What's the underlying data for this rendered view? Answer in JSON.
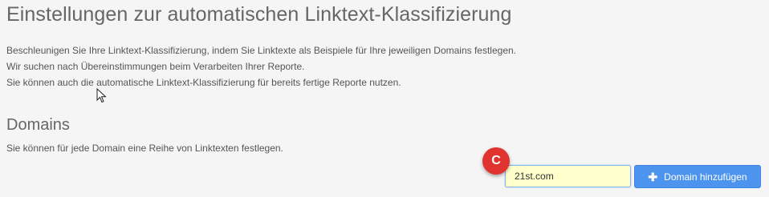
{
  "header": {
    "title": "Einstellungen zur automatischen Linktext-Klassifizierung"
  },
  "intro": {
    "line1": "Beschleunigen Sie Ihre Linktext-Klassifizierung, indem Sie Linktexte als Beispiele für Ihre jeweiligen Domains festlegen.",
    "line2": "Wir suchen nach Übereinstimmungen beim Verarbeiten Ihrer Reporte.",
    "line3": "Sie können auch die automatische Linktext-Klassifizierung für bereits fertige Reporte nutzen."
  },
  "domains": {
    "title": "Domains",
    "description": "Sie können für jede Domain eine Reihe von Linktexten festlegen.",
    "input_value": "21st.com",
    "add_button_label": "Domain hinzufügen",
    "add_button_icon": "plus-icon"
  },
  "annotation": {
    "marker_label": "C"
  },
  "colors": {
    "accent": "#4d94ee",
    "input_highlight": "#ffffcc",
    "marker": "#e0332f"
  }
}
